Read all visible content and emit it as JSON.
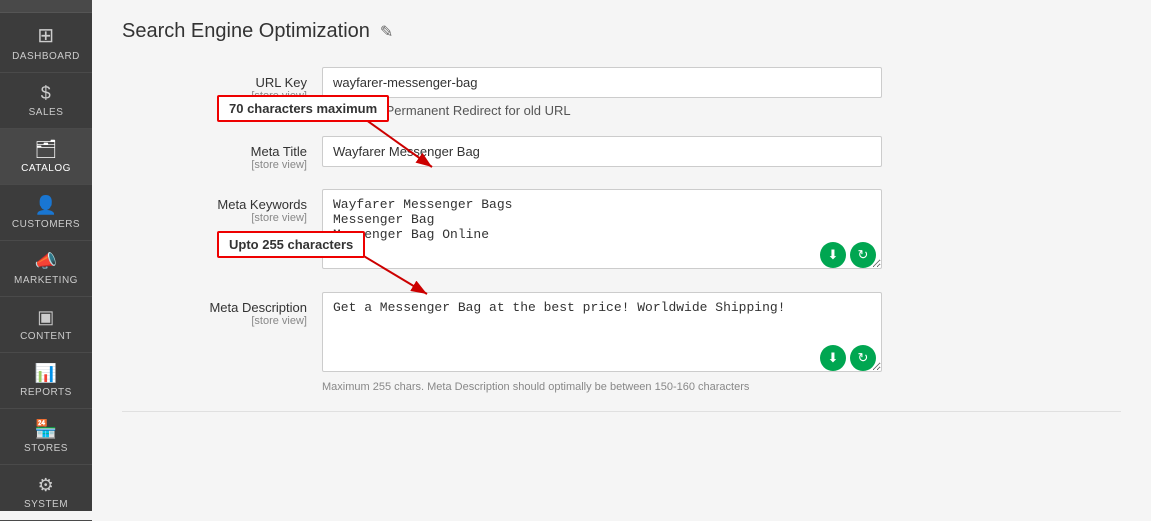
{
  "sidebar": {
    "items": [
      {
        "id": "dashboard",
        "label": "DASHBOARD",
        "icon": "⊞"
      },
      {
        "id": "sales",
        "label": "SALES",
        "icon": "$"
      },
      {
        "id": "catalog",
        "label": "CATALOG",
        "icon": "📦",
        "active": true
      },
      {
        "id": "customers",
        "label": "CUSTOMERS",
        "icon": "👤"
      },
      {
        "id": "marketing",
        "label": "MARKETING",
        "icon": "📣"
      },
      {
        "id": "content",
        "label": "CONTENT",
        "icon": "⬜"
      },
      {
        "id": "reports",
        "label": "REPORTS",
        "icon": "📊"
      },
      {
        "id": "stores",
        "label": "STORES",
        "icon": "🏪"
      },
      {
        "id": "system",
        "label": "SYSTEM",
        "icon": "⚙"
      }
    ]
  },
  "page": {
    "title": "Search Engine Optimization",
    "edit_icon": "✎"
  },
  "form": {
    "url_key": {
      "label": "URL Key",
      "sublabel": "[store view]",
      "value": "wayfarer-messenger-bag",
      "annotation": "70 characters maximum",
      "checkbox_label": "Create Permanent Redirect for old URL",
      "checkbox_checked": true
    },
    "meta_title": {
      "label": "Meta Title",
      "sublabel": "[store view]",
      "value": "Wayfarer Messenger Bag"
    },
    "meta_keywords": {
      "label": "Meta Keywords",
      "sublabel": "[store view]",
      "value": "Wayfarer Messenger Bags\nMessenger Bag\nMessenger Bag Online",
      "annotation": "Upto 255 characters"
    },
    "meta_description": {
      "label": "Meta Description",
      "sublabel": "[store view]",
      "value": "Get a Messenger Bag at the best price! Worldwide Shipping!",
      "hint": "Maximum 255 chars. Meta Description should optimally be between 150-160 characters"
    }
  }
}
